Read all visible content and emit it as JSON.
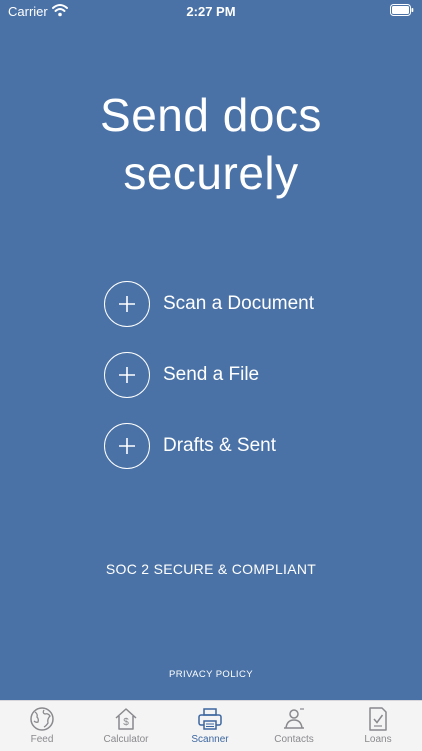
{
  "status_bar": {
    "carrier": "Carrier",
    "time": "2:27 PM"
  },
  "headline": {
    "line1": "Send docs",
    "line2": "securely"
  },
  "actions": [
    {
      "label": "Scan a Document",
      "icon": "plus-icon"
    },
    {
      "label": "Send a File",
      "icon": "plus-icon"
    },
    {
      "label": "Drafts & Sent",
      "icon": "plus-icon"
    }
  ],
  "compliance_text": "SOC 2 SECURE & COMPLIANT",
  "privacy_link": "PRIVACY POLICY",
  "tabs": [
    {
      "label": "Feed",
      "icon": "globe-icon",
      "active": false
    },
    {
      "label": "Calculator",
      "icon": "house-dollar-icon",
      "active": false
    },
    {
      "label": "Scanner",
      "icon": "printer-icon",
      "active": true
    },
    {
      "label": "Contacts",
      "icon": "contacts-icon",
      "active": false
    },
    {
      "label": "Loans",
      "icon": "document-check-icon",
      "active": false
    }
  ],
  "colors": {
    "background": "#4a72a6",
    "tab_active": "#3c67a0",
    "tab_inactive": "#8a8a8e",
    "tab_bar": "#f4f4f5"
  }
}
